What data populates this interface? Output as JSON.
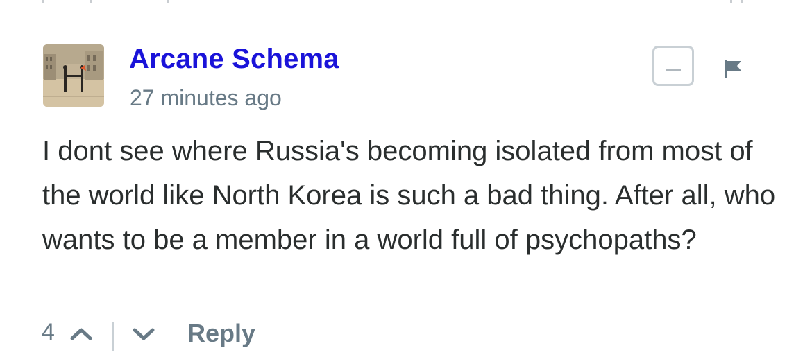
{
  "comment": {
    "author": "Arcane Schema",
    "timestamp": "27 minutes ago",
    "message": "I dont see where Russia's becoming isolated from most of the world like North Korea is such a bad thing. After all, who wants to be a member in a world full of psychopaths?",
    "votes": "4",
    "reply_label": "Reply"
  },
  "icons": {
    "avatar": "avatar-image",
    "collapse": "minus-icon",
    "flag": "flag-icon",
    "upvote": "chevron-up-icon",
    "downvote": "chevron-down-icon"
  },
  "colors": {
    "author": "#1a13d9",
    "muted": "#687a86",
    "text": "#2a2e2e",
    "border": "#c9d0d5"
  }
}
